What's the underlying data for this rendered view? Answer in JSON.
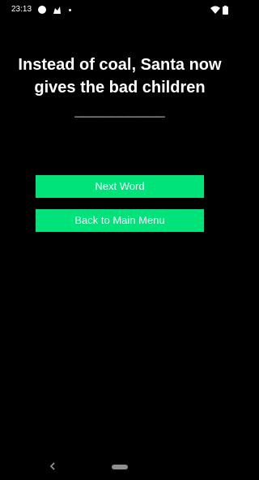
{
  "status_bar": {
    "time": "23:13",
    "left_icons": [
      "circle-icon",
      "app-notification-icon",
      "dot-icon"
    ],
    "right_icons": [
      "wifi-icon",
      "battery-icon"
    ]
  },
  "prompt": {
    "text": "Instead of coal, Santa now gives the bad children __________"
  },
  "buttons": {
    "next_word": "Next Word",
    "back_to_menu": "Back to Main Menu"
  },
  "navigation": {
    "icons": [
      "back-icon",
      "home-pill-icon"
    ]
  },
  "colors": {
    "background": "#000000",
    "button": "#00e27a",
    "text": "#ffffff"
  }
}
